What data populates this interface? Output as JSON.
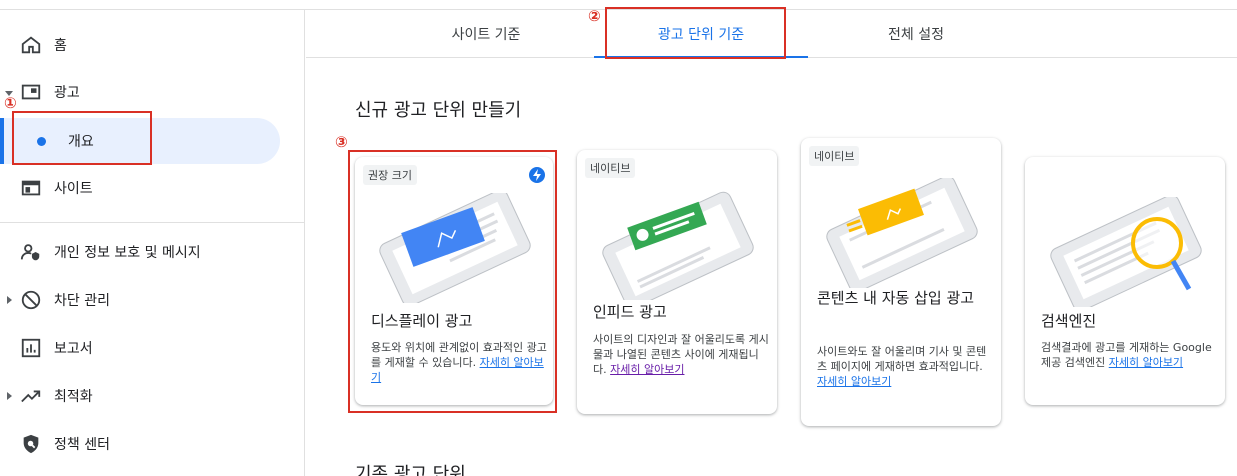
{
  "sidebar": {
    "items": [
      {
        "label": "홈",
        "icon": "home-icon"
      },
      {
        "label": "광고",
        "icon": "ad-icon"
      },
      {
        "label": "개요",
        "icon": "dot-icon"
      },
      {
        "label": "사이트",
        "icon": "site-icon"
      },
      {
        "label": "개인 정보 보호 및 메시지",
        "icon": "privacy-icon"
      },
      {
        "label": "차단 관리",
        "icon": "block-icon"
      },
      {
        "label": "보고서",
        "icon": "report-icon"
      },
      {
        "label": "최적화",
        "icon": "trending-icon"
      },
      {
        "label": "정책 센터",
        "icon": "policy-icon"
      }
    ]
  },
  "tabs": [
    {
      "label": "사이트 기준"
    },
    {
      "label": "광고 단위 기준"
    },
    {
      "label": "전체 설정"
    }
  ],
  "section": {
    "new_title": "신규 광고 단위 만들기",
    "existing_title": "기존 광고 단위"
  },
  "cards": [
    {
      "chip": "권장 크기",
      "title": "디스플레이 광고",
      "desc": "용도와 위치에 관계없이 효과적인 광고를 게재할 수 있습니다.",
      "link": "자세히 알아보기"
    },
    {
      "chip": "네이티브",
      "title": "인피드 광고",
      "desc": "사이트의 디자인과 잘 어울리도록 게시물과 나열된 콘텐츠 사이에 게재됩니다.",
      "link": "자세히 알아보기"
    },
    {
      "chip": "네이티브",
      "title": "콘텐츠 내 자동 삽입 광고",
      "desc": "사이트와도 잘 어울리며 기사 및 콘텐츠 페이지에 게재하면 효과적입니다.",
      "link": "자세히 알아보기"
    },
    {
      "chip": "",
      "title": "검색엔진",
      "desc": "검색결과에 광고를 게재하는 Google 제공 검색엔진",
      "link": "자세히 알아보기"
    }
  ],
  "annotations": {
    "m1": "①",
    "m2": "②",
    "m3": "③"
  },
  "colors": {
    "accent": "#1a73e8",
    "annotation": "#d93025",
    "active_bg": "#e8f0fe"
  }
}
